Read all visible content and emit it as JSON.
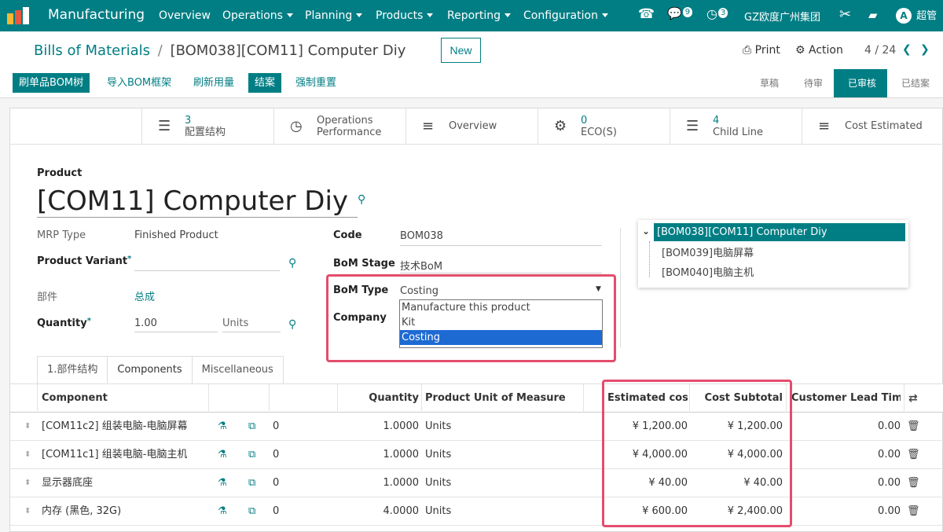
{
  "navbar": {
    "app": "Manufacturing",
    "menus": [
      "Overview",
      "Operations",
      "Planning",
      "Products",
      "Reporting",
      "Configuration"
    ],
    "menu_has_caret": [
      false,
      true,
      true,
      true,
      true,
      true
    ],
    "msg_count": "9",
    "activity_count": "3",
    "company": "GZ欧度广州集团",
    "user_initial": "A",
    "user_name": "超管"
  },
  "breadcrumb": {
    "root": "Bills of Materials",
    "sep": "/",
    "current": "[BOM038][COM11] Computer Diy"
  },
  "control": {
    "new": "New",
    "print": "Print",
    "action": "Action",
    "pager": "4 / 24"
  },
  "toolbar": {
    "btn1": "刷单品BOM树",
    "btn2": "导入BOM框架",
    "btn3": "刷新用量",
    "btn4": "结案",
    "btn5": "强制重置"
  },
  "statusbar": [
    "草稿",
    "待审",
    "已审核",
    "已结案"
  ],
  "status_active": "已审核",
  "smart_buttons": [
    {
      "num": "3",
      "label": "配置结构",
      "icon": "list-icon"
    },
    {
      "num": "",
      "label": "Operations",
      "label2": "Performance",
      "icon": "clock-icon"
    },
    {
      "num": "",
      "label": "Overview",
      "icon": "bars-icon"
    },
    {
      "num": "0",
      "label": "ECO(S)",
      "icon": "gears-icon"
    },
    {
      "num": "4",
      "label": "Child Line",
      "icon": "list-icon"
    },
    {
      "num": "",
      "label": "Cost Estimated",
      "icon": "bars-icon"
    }
  ],
  "form": {
    "product_label": "Product",
    "product": "[COM11] Computer Diy",
    "mrp_type_label": "MRP Type",
    "mrp_type": "Finished Product",
    "variant_label": "Product Variant",
    "part_label": "部件",
    "part": "总成",
    "quantity_label": "Quantity",
    "quantity": "1.00",
    "uom": "Units",
    "code_label": "Code",
    "code": "BOM038",
    "stage_label": "BoM Stage",
    "stage": "技术BoM",
    "type_label": "BoM Type",
    "type": "Costing",
    "company_label": "Company"
  },
  "dropdown": {
    "options": [
      "Manufacture this product",
      "Kit",
      "Costing"
    ],
    "selected": "Costing"
  },
  "tree": {
    "root": "[BOM038][COM11] Computer Diy",
    "children": [
      "[BOM039]电脑屏幕",
      "[BOM040]电脑主机"
    ]
  },
  "tabs": [
    "1.部件结构",
    "Components",
    "Miscellaneous"
  ],
  "tab_active": "Components",
  "grid": {
    "headers": {
      "component": "Component",
      "quantity": "Quantity",
      "uom": "Product Unit of Measure",
      "est_cost": "Estimated cost",
      "subtotal": "Cost Subtotal",
      "lead": "Customer Lead Time"
    },
    "rows": [
      {
        "component": "[COM11c2] 组装电脑-电脑屏幕",
        "seq": "0",
        "quantity": "1.0000",
        "uom": "Units",
        "est_cost": "¥ 1,200.00",
        "subtotal": "¥ 1,200.00",
        "lead": "0.00"
      },
      {
        "component": "[COM11c1] 组装电脑-电脑主机",
        "seq": "0",
        "quantity": "1.0000",
        "uom": "Units",
        "est_cost": "¥ 4,000.00",
        "subtotal": "¥ 4,000.00",
        "lead": "0.00"
      },
      {
        "component": "显示器底座",
        "seq": "0",
        "quantity": "1.0000",
        "uom": "Units",
        "est_cost": "¥ 40.00",
        "subtotal": "¥ 40.00",
        "lead": "0.00"
      },
      {
        "component": "内存 (黑色, 32G)",
        "seq": "0",
        "quantity": "4.0000",
        "uom": "Units",
        "est_cost": "¥ 600.00",
        "subtotal": "¥ 2,400.00",
        "lead": "0.00"
      }
    ]
  },
  "colors": {
    "brand": "#017e84",
    "highlight": "#e34d6c",
    "selection": "#1e6ad3"
  }
}
